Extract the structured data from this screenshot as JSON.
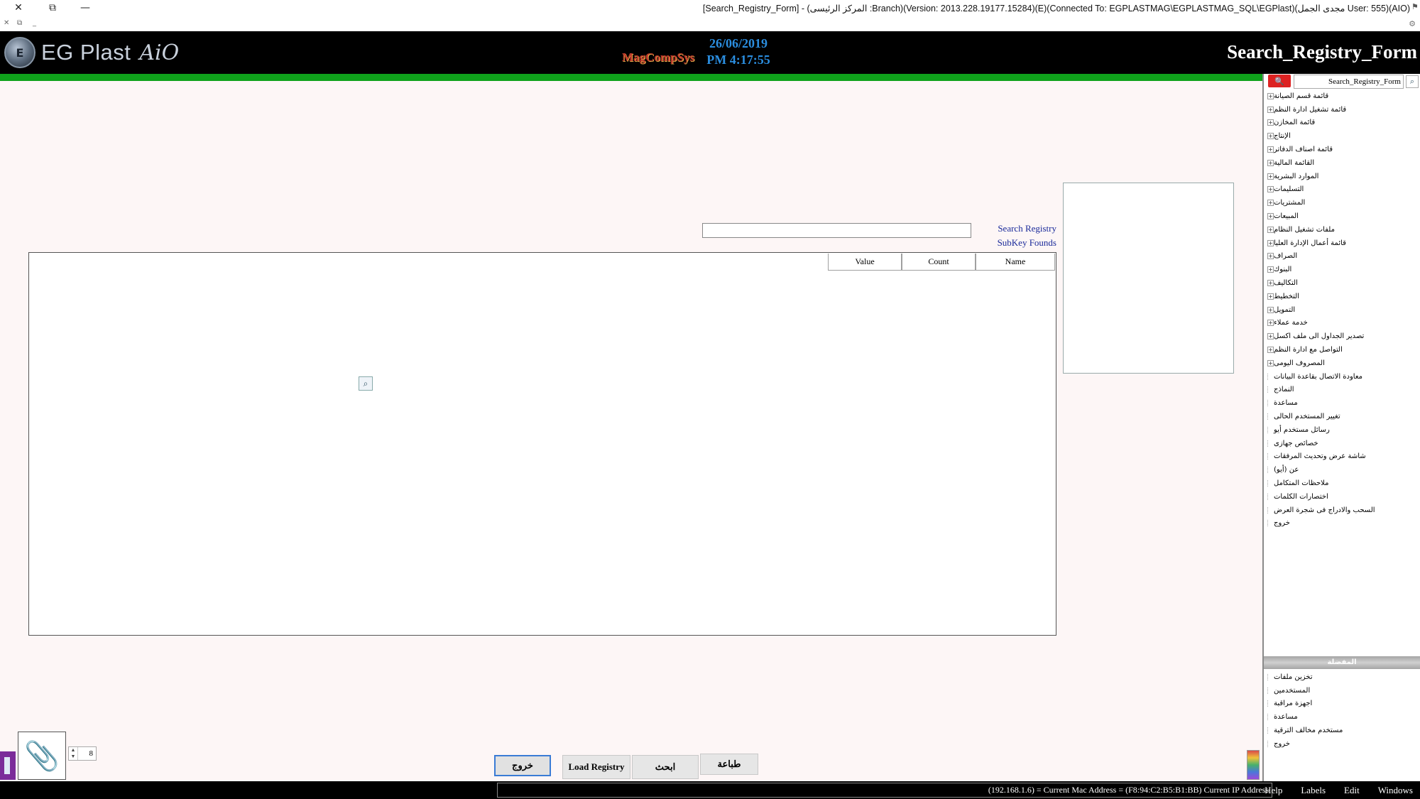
{
  "window": {
    "title": "[Search_Registry_Form] - (المركز الرئيسى :Branch)(Version: 2013.228.19177.15284)(E)(Connected To: EGPLASTMAG\\EGPLASTMAG_SQL\\EGPlast)(مجدى الجمل User: 555)(AIO)",
    "close_glyph": "✕",
    "restore_glyph": "⧉",
    "minimize_glyph": "—",
    "mdi_close": "✕",
    "mdi_restore": "⧉",
    "mdi_min": "_"
  },
  "header": {
    "logo_text": "EG Plast",
    "logo_suffix": "AiO",
    "brand_mid": "MagCompSys",
    "date": "26/06/2019",
    "time": "PM 4:17:55",
    "form_title": "Search_Registry_Form"
  },
  "form": {
    "search_label": "Search Registry",
    "search_value": "",
    "subkey_label": "SubKey Founds",
    "grid_columns": [
      "Name",
      "Count",
      "Value"
    ],
    "buttons": {
      "exit": "خروج",
      "load": "Load Registry",
      "search": "ابحث",
      "print": "طباعة"
    },
    "page_number": "8"
  },
  "side": {
    "search_value": "Search_Registry_Form",
    "tree": [
      {
        "label": "قائمة قسم الصيانة",
        "expandable": true
      },
      {
        "label": "قائمة تشغيل ادارة النظم",
        "expandable": true
      },
      {
        "label": "قائمة المخازن",
        "expandable": true
      },
      {
        "label": "الإنتاج",
        "expandable": true
      },
      {
        "label": "قائمة اصناف الدفاتر",
        "expandable": true
      },
      {
        "label": "القائمة المالية",
        "expandable": true
      },
      {
        "label": "الموارد البشرية",
        "expandable": true
      },
      {
        "label": "التسليمات",
        "expandable": true
      },
      {
        "label": "المشتريات",
        "expandable": true
      },
      {
        "label": "المبيعات",
        "expandable": true
      },
      {
        "label": "ملفات تشغيل النظام",
        "expandable": true
      },
      {
        "label": "قائمة أعمال الإدارة العليا",
        "expandable": true
      },
      {
        "label": "الصراف",
        "expandable": true
      },
      {
        "label": "البنوك",
        "expandable": true
      },
      {
        "label": "التكاليف",
        "expandable": true
      },
      {
        "label": "التخطيط",
        "expandable": true
      },
      {
        "label": "التمويل",
        "expandable": true
      },
      {
        "label": "خدمة عملاء",
        "expandable": true
      },
      {
        "label": "تصدير الجداول الى ملف اكسل",
        "expandable": true
      },
      {
        "label": "التواصل مع ادارة النظم",
        "expandable": true
      },
      {
        "label": "المصروف اليومى",
        "expandable": true
      },
      {
        "label": "معاودة الاتصال بقاعدة البيانات",
        "expandable": false
      },
      {
        "label": "النماذج",
        "expandable": false
      },
      {
        "label": "مساعدة",
        "expandable": false
      },
      {
        "label": "تغيير المستخدم الحالى",
        "expandable": false
      },
      {
        "label": "رسائل مستخدم أيو",
        "expandable": false
      },
      {
        "label": "خصائص جهازى",
        "expandable": false
      },
      {
        "label": "شاشة عرض وتحديث المرفقات",
        "expandable": false
      },
      {
        "label": "عن (أيو)",
        "expandable": false
      },
      {
        "label": "ملاحظات المتكامل",
        "expandable": false
      },
      {
        "label": "اختصارات الكلمات",
        "expandable": false
      },
      {
        "label": "السحب والادراج فى شجرة العرض",
        "expandable": false
      },
      {
        "label": "خروج",
        "expandable": false
      }
    ],
    "favorites_title": "المفضلة",
    "favorites": [
      {
        "label": "تخزين ملفات"
      },
      {
        "label": "المستخدمين"
      },
      {
        "label": "اجهزة مراقبة"
      },
      {
        "label": "مساعدة"
      },
      {
        "label": "مستخدم مخالف الترقية"
      },
      {
        "label": "خروج"
      }
    ]
  },
  "statusbar": {
    "text": "(192.168.1.6) = Current Mac Address = (F8:94:C2:B5:B1:BB) Current IP Address",
    "menu": [
      "Help",
      "Labels",
      "Edit",
      "Windows"
    ]
  },
  "colors": {
    "header_bg": "#000000",
    "progress_green": "#0fa21b",
    "datetime": "#2b8ee0",
    "label_blue": "#1a2a9a",
    "main_bg": "#fdf6f6"
  }
}
